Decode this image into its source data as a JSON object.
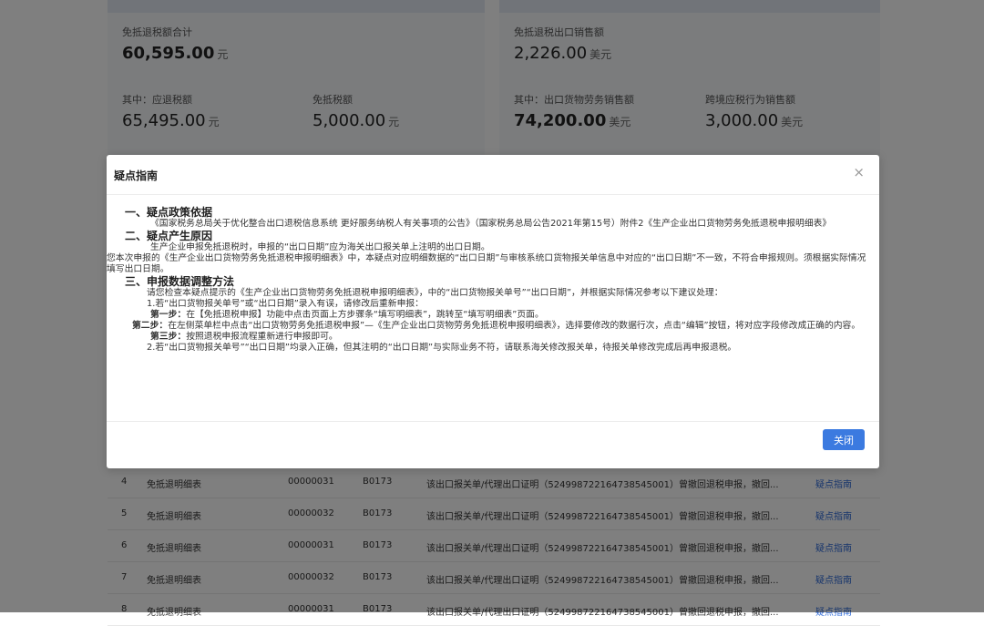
{
  "summary": {
    "left": {
      "total_label": "免抵退税额合计",
      "total_value": "60,595.00",
      "total_unit": "元",
      "refund_label": "其中：应退税额",
      "refund_value": "65,495.00",
      "refund_unit": "元",
      "exempt_label": "免抵税额",
      "exempt_value": "5,000.00",
      "exempt_unit": "元"
    },
    "right": {
      "sales_label": "免抵退税出口销售额",
      "sales_value": "2,226.00",
      "sales_unit": "美元",
      "goods_label": "其中：出口货物劳务销售额",
      "goods_value": "74,200.00",
      "goods_unit": "美元",
      "cross_label": "跨境应税行为销售额",
      "cross_value": "3,000.00",
      "cross_unit": "美元"
    }
  },
  "table": {
    "rows": [
      {
        "index": "4",
        "name": "免抵退明细表",
        "code": "00000031",
        "error": "B0173",
        "desc": "该出口报关单/代理出口证明（524998722164738545001）曾撤回退税申报，撤回...",
        "link": "疑点指南"
      },
      {
        "index": "5",
        "name": "免抵退明细表",
        "code": "00000032",
        "error": "B0173",
        "desc": "该出口报关单/代理出口证明（524998722164738545001）曾撤回退税申报，撤回...",
        "link": "疑点指南"
      },
      {
        "index": "6",
        "name": "免抵退明细表",
        "code": "00000031",
        "error": "B0173",
        "desc": "该出口报关单/代理出口证明（524998722164738545001）曾撤回退税申报，撤回...",
        "link": "疑点指南"
      },
      {
        "index": "7",
        "name": "免抵退明细表",
        "code": "00000032",
        "error": "B0173",
        "desc": "该出口报关单/代理出口证明（524998722164738545001）曾撤回退税申报，撤回...",
        "link": "疑点指南"
      },
      {
        "index": "8",
        "name": "免抵退明细表",
        "code": "00000031",
        "error": "B0173",
        "desc": "该出口报关单/代理出口证明（524998722164738545001）曾撤回退税申报，撤回...",
        "link": "疑点指南"
      }
    ]
  },
  "modal": {
    "title": "疑点指南",
    "close_icon": "×",
    "s1_title": "一、疑点政策依据",
    "s1_text": "《国家税务总局关于优化整合出口退税信息系统 更好服务纳税人有关事项的公告》（国家税务总局公告2021年第15号）附件2《生产企业出口货物劳务免抵退税申报明细表》",
    "s2_title": "二、疑点产生原因",
    "s2_text1": "生产企业申报免抵退税时，申报的“出口日期”应为海关出口报关单上注明的出口日期。",
    "s2_text2": "您本次申报的《生产企业出口货物劳务免抵退税申报明细表》中，本疑点对应明细数据的“出口日期”与审核系统口货物报关单信息中对应的“出口日期”不一致，不符合申报规则。须根据实际情况填写出口日期。",
    "s3_title": "三、申报数据调整方法",
    "s3_text1": "请您检查本疑点提示的《生产企业出口货物劳务免抵退税申报明细表》，中的“出口货物报关单号”“出口日期”，并根据实际情况参考以下建议处理：",
    "s3_item1": "1.若“出口货物报关单号”或“出口日期”录入有误，请修改后重新申报：",
    "step1_label": "第一步：",
    "step1_text": "在【免抵退税申报】功能中点击页面上方步骤条“填写明细表”，跳转至“填写明细表”页面。",
    "step2_label": "第二步：",
    "step2_text": "在左侧菜单栏中点击“出口货物劳务免抵退税申报”—《生产企业出口货物劳务免抵退税申报明细表》，选择要修改的数据行次，点击“编辑”按钮，将对应字段修改成正确的内容。",
    "step3_label": "第三步：",
    "step3_text": "按照退税申报流程重新进行申报即可。",
    "s3_item2": "2.若“出口货物报关单号”“出口日期”均录入正确，但其注明的“出口日期”与实际业务不符，请联系海关修改报关单，待报关单修改完成后再申报退税。",
    "close_button": "关闭"
  }
}
